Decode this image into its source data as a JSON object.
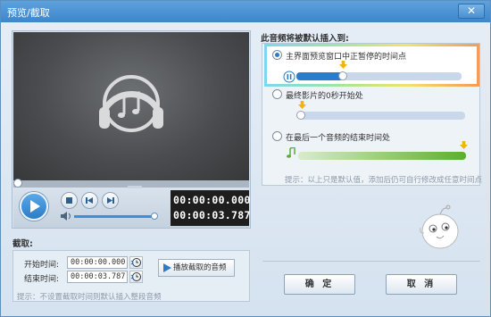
{
  "window": {
    "title": "预览/截取",
    "close": "✕"
  },
  "player": {
    "current_time": "00:00:00.000",
    "total_time": "00:00:03.787",
    "volume_percent": 100,
    "seek_percent": 0
  },
  "cut": {
    "section_label": "截取:",
    "start_label": "开始时间:",
    "start_value": "00:00:00.000",
    "end_label": "结束时间:",
    "end_value": "00:00:03.787",
    "play_button": "播放截取的音频",
    "hint": "提示：不设置截取时间则默认插入整段音频"
  },
  "insert": {
    "section_title": "此音频将被默认插入到:",
    "options": [
      {
        "label": "主界面预览窗口中正暂停的时间点",
        "selected": true
      },
      {
        "label": "最终影片的0秒开始处",
        "selected": false
      },
      {
        "label": "在最后一个音频的结束时间处",
        "selected": false
      }
    ],
    "hint": "提示：以上只是默认值，添加后仍可自行修改成任意时间点"
  },
  "buttons": {
    "ok": "确 定",
    "cancel": "取 消"
  },
  "colors": {
    "accent": "#2c7cc7",
    "titlebar": "#4a93d5",
    "marker": "#f5b400",
    "green": "#5ab02e"
  }
}
